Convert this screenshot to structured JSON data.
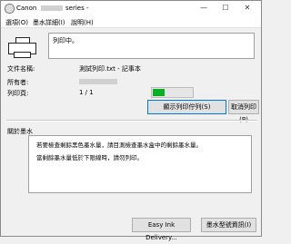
{
  "window": {
    "brand": "Canon",
    "title_suffix": "series -",
    "controls": {
      "minimize": "—",
      "maximize": "☐",
      "close": "✕"
    }
  },
  "menu": [
    "選項(O)",
    "墨水詳細(I)",
    "說明(H)"
  ],
  "status": {
    "text": "列印中。"
  },
  "info": {
    "document_label": "文件名稱:",
    "document_value": "測試列印.txt - 記事本",
    "owner_label": "所有者:",
    "pages_label": "列印頁:",
    "pages_value": "1 / 1",
    "progress_fraction": 0.3
  },
  "buttons": {
    "show_print_queue": "顯示列印佇列(S)",
    "cancel_printing": "取消列印(P)",
    "easy_ink_delivery": "Easy Ink Delivery...",
    "ink_model_number": "墨水型號資訊(I)"
  },
  "ink_section": {
    "title": "關於墨水",
    "line1": "若要檢查剩餘黑色墨水量，請目測檢查墨水盒中的剩餘墨水量。",
    "line2": "當剩餘墨水量低於下限線時，請勿列印。"
  }
}
